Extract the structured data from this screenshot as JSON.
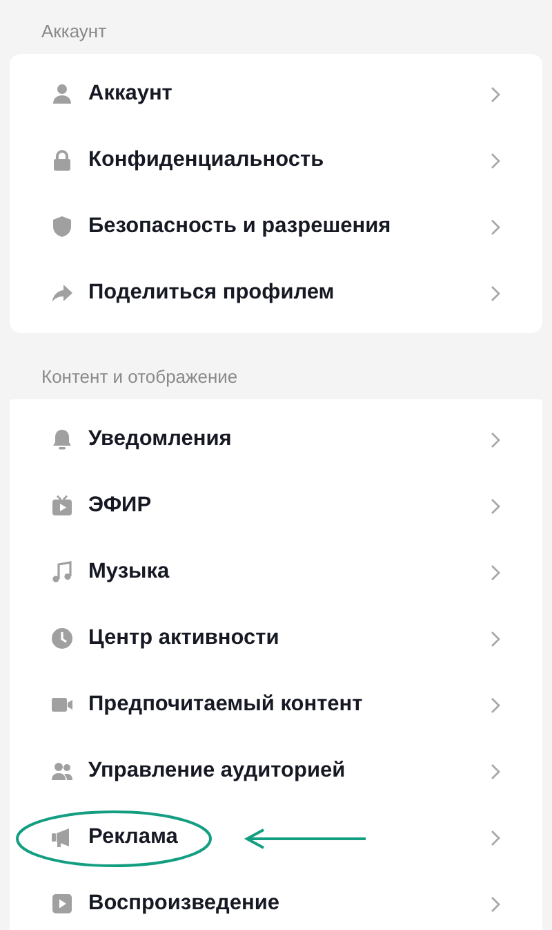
{
  "sections": [
    {
      "title": "Аккаунт",
      "items": [
        {
          "label": "Аккаунт",
          "annotated": false
        },
        {
          "label": "Конфиденциальность",
          "annotated": false
        },
        {
          "label": "Безопасность и разрешения",
          "annotated": false
        },
        {
          "label": "Поделиться профилем",
          "annotated": false
        }
      ]
    },
    {
      "title": "Контент и отображение",
      "items": [
        {
          "label": "Уведомления",
          "annotated": false
        },
        {
          "label": "ЭФИР",
          "annotated": false
        },
        {
          "label": "Музыка",
          "annotated": false
        },
        {
          "label": "Центр активности",
          "annotated": false
        },
        {
          "label": "Предпочитаемый контент",
          "annotated": false
        },
        {
          "label": "Управление аудиторией",
          "annotated": false
        },
        {
          "label": "Реклама",
          "annotated": true
        },
        {
          "label": "Воспроизведение",
          "annotated": false
        }
      ]
    }
  ]
}
